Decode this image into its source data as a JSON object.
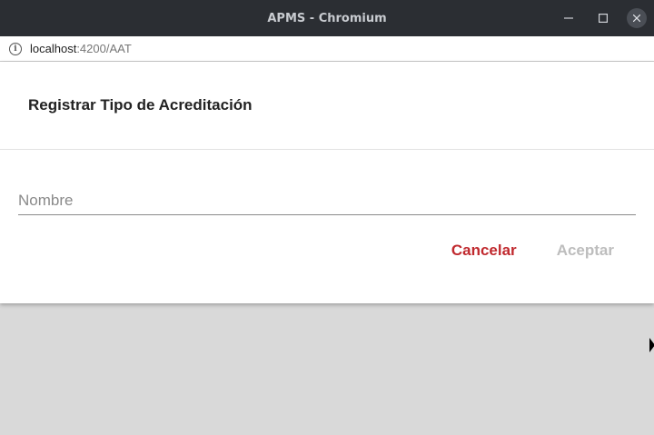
{
  "window": {
    "title": "APMS - Chromium",
    "controls": {
      "minimize": "minimize",
      "maximize": "maximize",
      "close": "close"
    }
  },
  "address_bar": {
    "host": "localhost",
    "path": ":4200/AAT"
  },
  "dialog": {
    "title": "Registrar Tipo de Acreditación",
    "name_field": {
      "value": "",
      "placeholder": "Nombre"
    },
    "cancel_label": "Cancelar",
    "accept_label": "Aceptar"
  },
  "colors": {
    "titlebar": "#2b2e33",
    "cancel": "#c0292e",
    "accept_disabled": "#bdbdbd",
    "backdrop": "#d9d9d9"
  }
}
